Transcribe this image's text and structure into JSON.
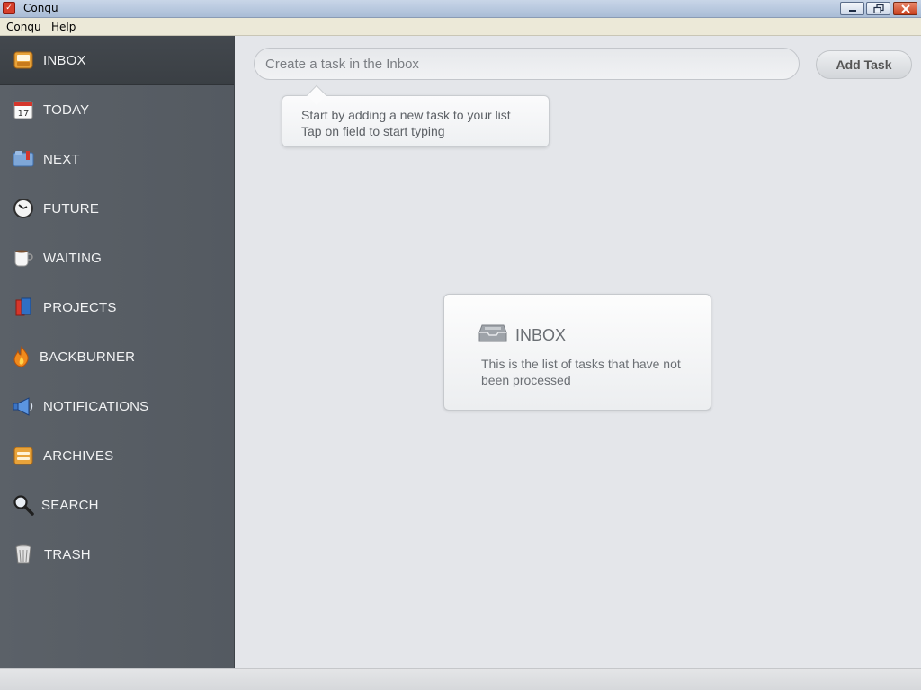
{
  "window": {
    "title": "Conqu",
    "app_icon_glyph": "✓"
  },
  "menu": {
    "items": [
      "Conqu",
      "Help"
    ]
  },
  "sidebar": {
    "active_index": 0,
    "items": [
      {
        "label": "INBOX",
        "icon": "inbox-tray-icon"
      },
      {
        "label": "TODAY",
        "icon": "calendar-icon",
        "calendar_day": "17"
      },
      {
        "label": "NEXT",
        "icon": "folder-icon"
      },
      {
        "label": "FUTURE",
        "icon": "clock-icon"
      },
      {
        "label": "WAITING",
        "icon": "coffee-cup-icon"
      },
      {
        "label": "PROJECTS",
        "icon": "books-icon"
      },
      {
        "label": "BACKBURNER",
        "icon": "flame-icon"
      },
      {
        "label": "NOTIFICATIONS",
        "icon": "megaphone-icon"
      },
      {
        "label": "ARCHIVES",
        "icon": "archive-box-icon"
      },
      {
        "label": "SEARCH",
        "icon": "magnifier-icon"
      },
      {
        "label": "TRASH",
        "icon": "trash-can-icon"
      }
    ]
  },
  "main": {
    "task_input": {
      "value": "",
      "placeholder": "Create a task in the Inbox"
    },
    "add_task_label": "Add Task",
    "tooltip": {
      "line1": "Start by adding a new task to your list",
      "line2": "Tap on field to start typing"
    },
    "info_card": {
      "title": "INBOX",
      "description": "This is the list of tasks that have not been processed",
      "icon": "inbox-tray-icon"
    }
  },
  "colors": {
    "sidebar_bg": "#575d64",
    "sidebar_active": "#3f4449",
    "main_bg": "#e4e6ea",
    "text_muted": "#6b6f74"
  }
}
